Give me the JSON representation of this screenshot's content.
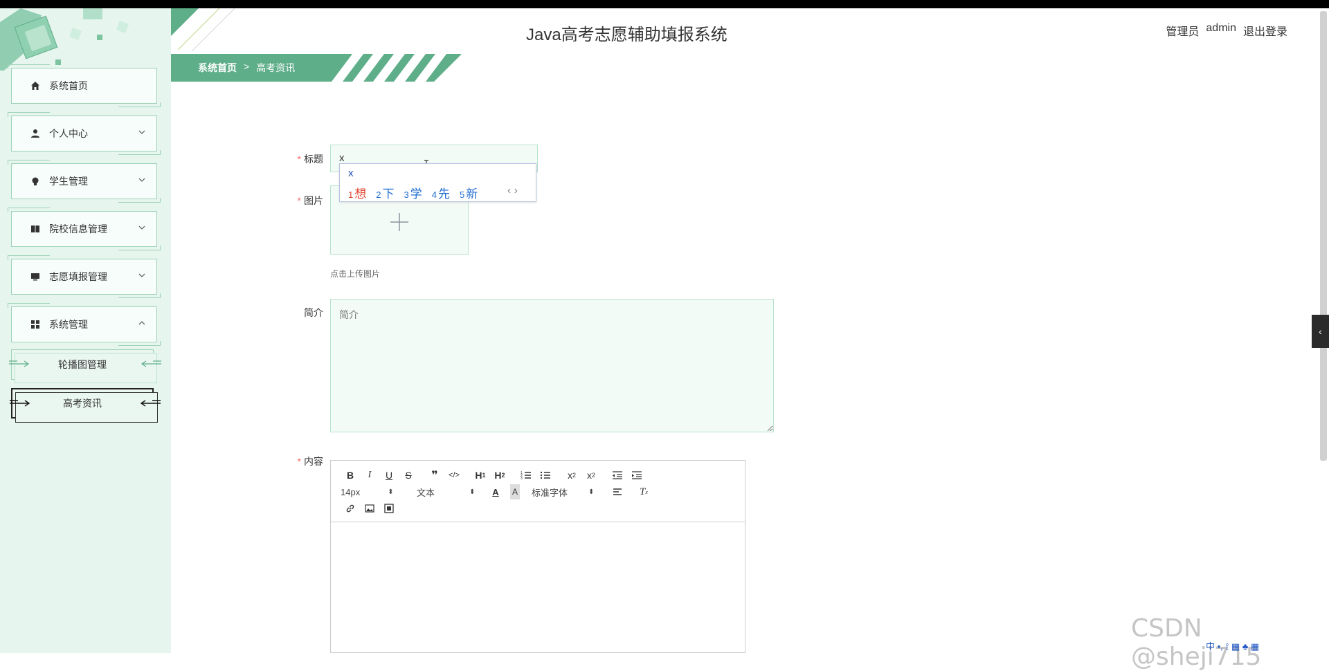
{
  "header": {
    "title": "Java高考志愿辅助填报系统",
    "role": "管理员",
    "username": "admin",
    "logout": "退出登录"
  },
  "breadcrumb": {
    "home": "系统首页",
    "separator": ">",
    "current": "高考资讯"
  },
  "sidebar": {
    "items": [
      {
        "label": "系统首页",
        "icon": "home-icon",
        "expandable": false
      },
      {
        "label": "个人中心",
        "icon": "user-icon",
        "expandable": true,
        "expanded": false
      },
      {
        "label": "学生管理",
        "icon": "lightbulb-icon",
        "expandable": true,
        "expanded": false
      },
      {
        "label": "院校信息管理",
        "icon": "book-icon",
        "expandable": true,
        "expanded": false
      },
      {
        "label": "志愿填报管理",
        "icon": "monitor-icon",
        "expandable": true,
        "expanded": false
      },
      {
        "label": "系统管理",
        "icon": "grid-icon",
        "expandable": true,
        "expanded": true
      }
    ],
    "subitems": [
      {
        "label": "轮播图管理",
        "active": false
      },
      {
        "label": "高考资讯",
        "active": true
      }
    ]
  },
  "form": {
    "title_label": "标题",
    "title_value": "x",
    "image_label": "图片",
    "upload_hint": "点击上传图片",
    "intro_label": "简介",
    "intro_placeholder": "简介",
    "content_label": "内容"
  },
  "ime": {
    "pinyin": "x",
    "candidates": [
      {
        "n": "1",
        "text": "想"
      },
      {
        "n": "2",
        "text": "下"
      },
      {
        "n": "3",
        "text": "学"
      },
      {
        "n": "4",
        "text": "先"
      },
      {
        "n": "5",
        "text": "新"
      }
    ],
    "nav": "‹ ›"
  },
  "editor": {
    "font_size": "14px",
    "text_type": "文本",
    "font_family": "标准字体"
  },
  "watermark": "CSDN @sheji715",
  "ime_tray": "中 •, ⟟ ▦ ♣ ▦",
  "colors": {
    "accent": "#5fae8a",
    "sidebar_bg": "#e6f5ee",
    "required": "#f56c6c"
  }
}
